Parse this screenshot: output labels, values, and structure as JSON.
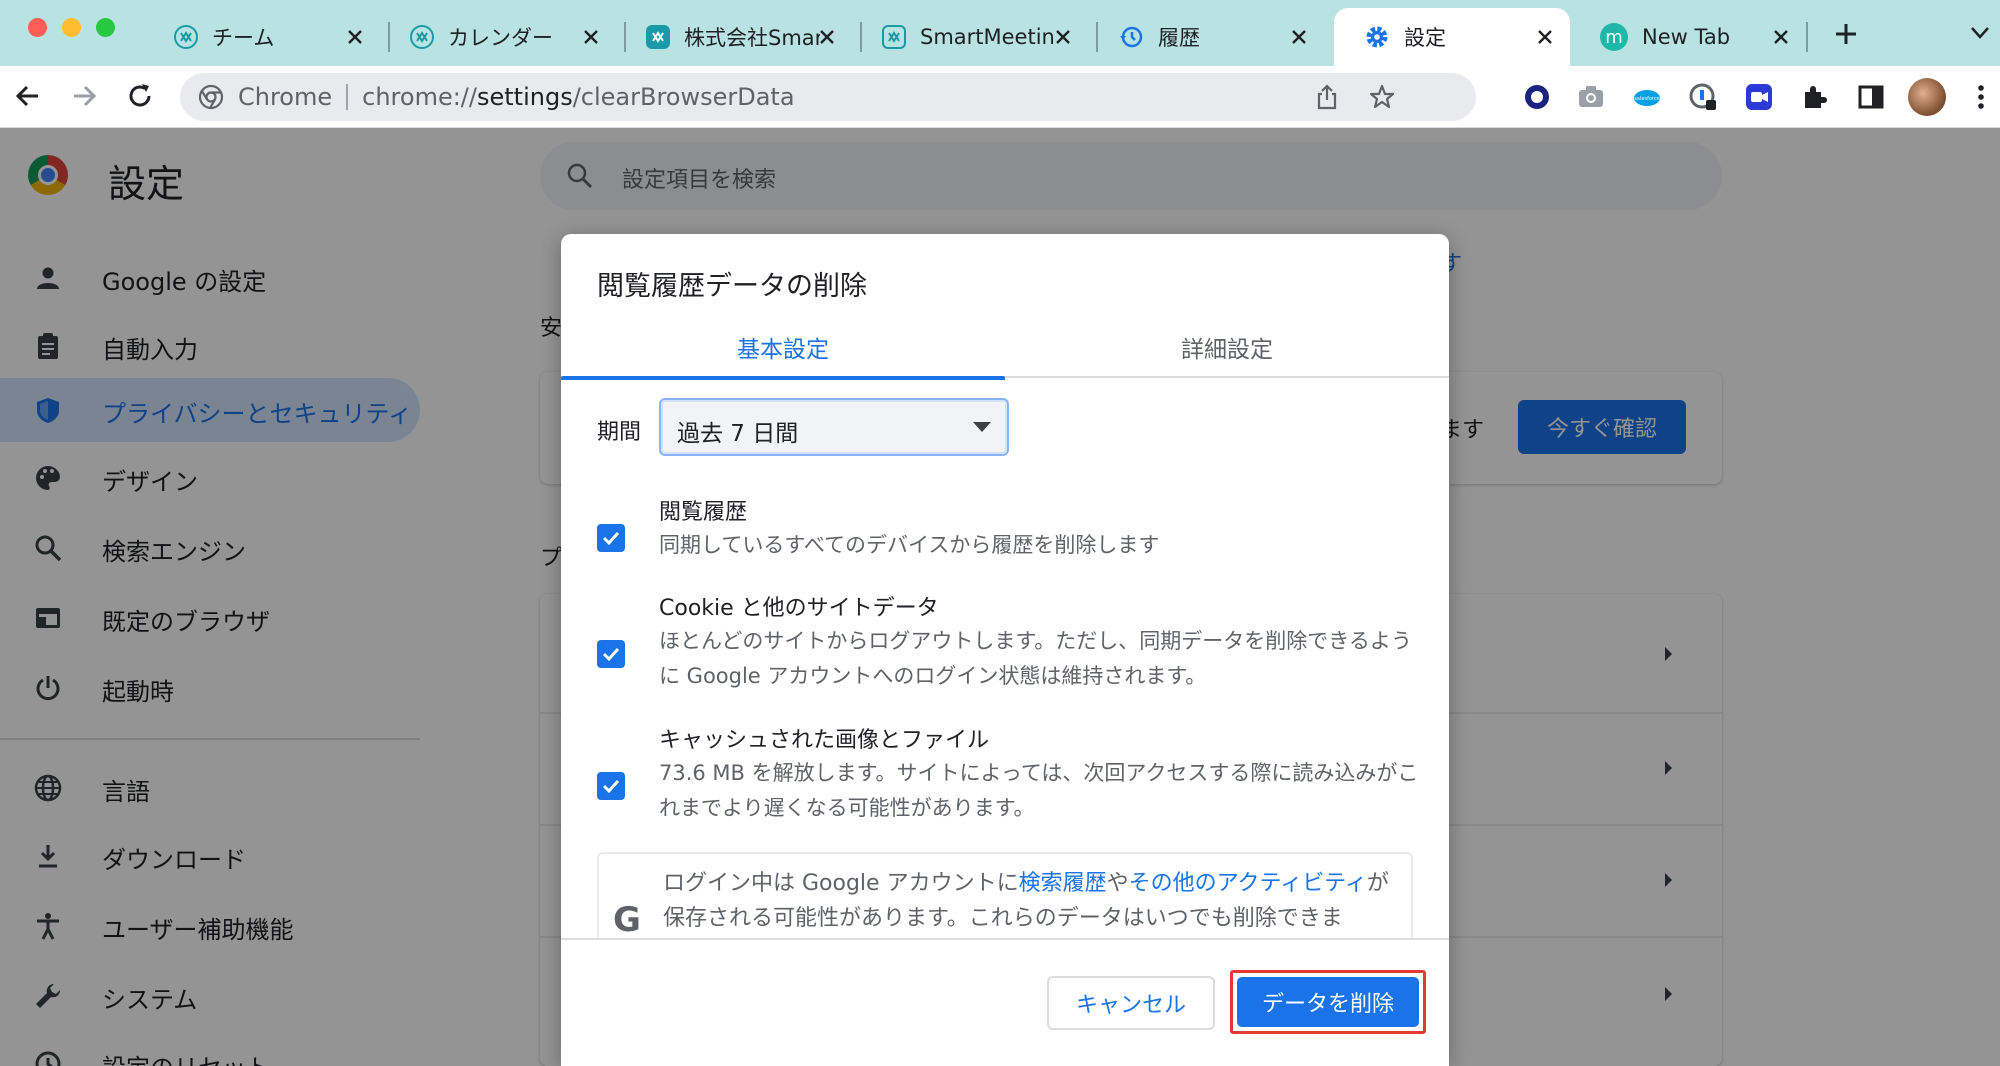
{
  "browser": {
    "tabs": [
      {
        "title": "チーム",
        "icon": "smartmeeting-icon"
      },
      {
        "title": "カレンダー",
        "icon": "smartmeeting-icon"
      },
      {
        "title": "株式会社Smar",
        "icon": "smartmeeting-icon"
      },
      {
        "title": "SmartMeetin",
        "icon": "smartmeeting-icon"
      },
      {
        "title": "履歴",
        "icon": "history-icon"
      },
      {
        "title": "設定",
        "icon": "gear-icon"
      },
      {
        "title": "New Tab",
        "icon": "m-icon"
      }
    ],
    "active_tab": 5,
    "omnibox": {
      "site_label": "Chrome",
      "url_scheme": "chrome://",
      "url_host": "settings",
      "url_path": "/clearBrowserData"
    }
  },
  "settings": {
    "title": "設定",
    "search_placeholder": "設定項目を検索",
    "sidebar": [
      {
        "label": "Google の設定",
        "icon": "person-icon"
      },
      {
        "label": "自動入力",
        "icon": "clipboard-icon"
      },
      {
        "label": "プライバシーとセキュリティ",
        "icon": "shield-icon"
      },
      {
        "label": "デザイン",
        "icon": "palette-icon"
      },
      {
        "label": "検索エンジン",
        "icon": "search-icon"
      },
      {
        "label": "既定のブラウザ",
        "icon": "browser-icon"
      },
      {
        "label": "起動時",
        "icon": "power-icon"
      },
      {
        "label": "言語",
        "icon": "globe-icon"
      },
      {
        "label": "ダウンロード",
        "icon": "download-icon"
      },
      {
        "label": "ユーザー補助機能",
        "icon": "accessibility-icon"
      },
      {
        "label": "システム",
        "icon": "wrench-icon"
      },
      {
        "label": "設定のリセット",
        "icon": "reset-icon"
      }
    ],
    "active_item": 2,
    "bg_section_safety_char": "安",
    "bg_section_privacy_char": "プ",
    "bg_card_text_tail": "ます",
    "bg_check_button": "今すぐ確認",
    "bg_link_char": "す"
  },
  "dialog": {
    "title": "閲覧履歴データの削除",
    "tabs": [
      "基本設定",
      "詳細設定"
    ],
    "active_tab": 0,
    "period_label": "期間",
    "period_value": "過去 7 日間",
    "options": [
      {
        "title": "閲覧履歴",
        "desc": "同期しているすべてのデバイスから履歴を削除します",
        "checked": true
      },
      {
        "title": "Cookie と他のサイトデータ",
        "desc": "ほとんどのサイトからログアウトします。ただし、同期データを削除できるように Google アカウントへのログイン状態は維持されます。",
        "checked": true
      },
      {
        "title": "キャッシュされた画像とファイル",
        "desc": "73.6 MB を解放します。サイトによっては、次回アクセスする際に読み込みがこれまでより遅くなる可能性があります。",
        "checked": true
      }
    ],
    "info": {
      "glyph": "G",
      "prefix": "ログイン中は Google アカウントに",
      "link1": "検索履歴",
      "mid": "や",
      "link2": "その他のアクティビティ",
      "suffix": "が保存される可能性があります。これらのデータはいつでも削除できま"
    },
    "cancel_label": "キャンセル",
    "delete_label": "データを削除"
  },
  "colors": {
    "accent": "#1a73e8",
    "tabstrip": "#b9e2e2",
    "highlight_border": "#e53935"
  }
}
